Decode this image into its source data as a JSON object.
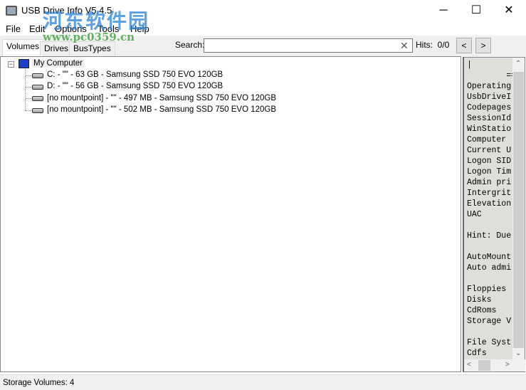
{
  "window": {
    "title": "USB Drive Info V5.4.5",
    "minimize": "─",
    "maximize": "☐",
    "close": "✕"
  },
  "menu": [
    "File",
    "Edit",
    "Options",
    "Tools",
    "Help"
  ],
  "tabs": [
    "Volumes",
    "Drives",
    "BusTypes"
  ],
  "search": {
    "label": "Search:",
    "value": "",
    "clear": "✕",
    "hits_label": "Hits:",
    "hits": "0/0",
    "prev": "<",
    "next": ">"
  },
  "tree": {
    "root": "My Computer",
    "items": [
      "C: - \"\" - 63 GB - Samsung SSD 750 EVO 120GB",
      "D: - \"\" - 56 GB - Samsung SSD 750 EVO 120GB",
      "[no mountpoint] - \"\" - 497 MB - Samsung SSD 750 EVO 120GB",
      "[no mountpoint] - \"\" - 502 MB - Samsung SSD 750 EVO 120GB"
    ]
  },
  "info_text": "|\n        ===\nOperating\nUsbDriveI\nCodepages\nSessionId\nWinStatio\nComputer\nCurrent U\nLogon SID\nLogon Tim\nAdmin pri\nIntergrit\nElevation\nUAC\n\nHint: Due\n\nAutoMount\nAuto admi\n\nFloppies\nDisks\nCdRoms\nStorage V\n\nFile Syst\nCdfs",
  "status": "Storage Volumes: 4",
  "watermark": {
    "name": "河东软件园",
    "url": "www.pc0359.cn"
  }
}
